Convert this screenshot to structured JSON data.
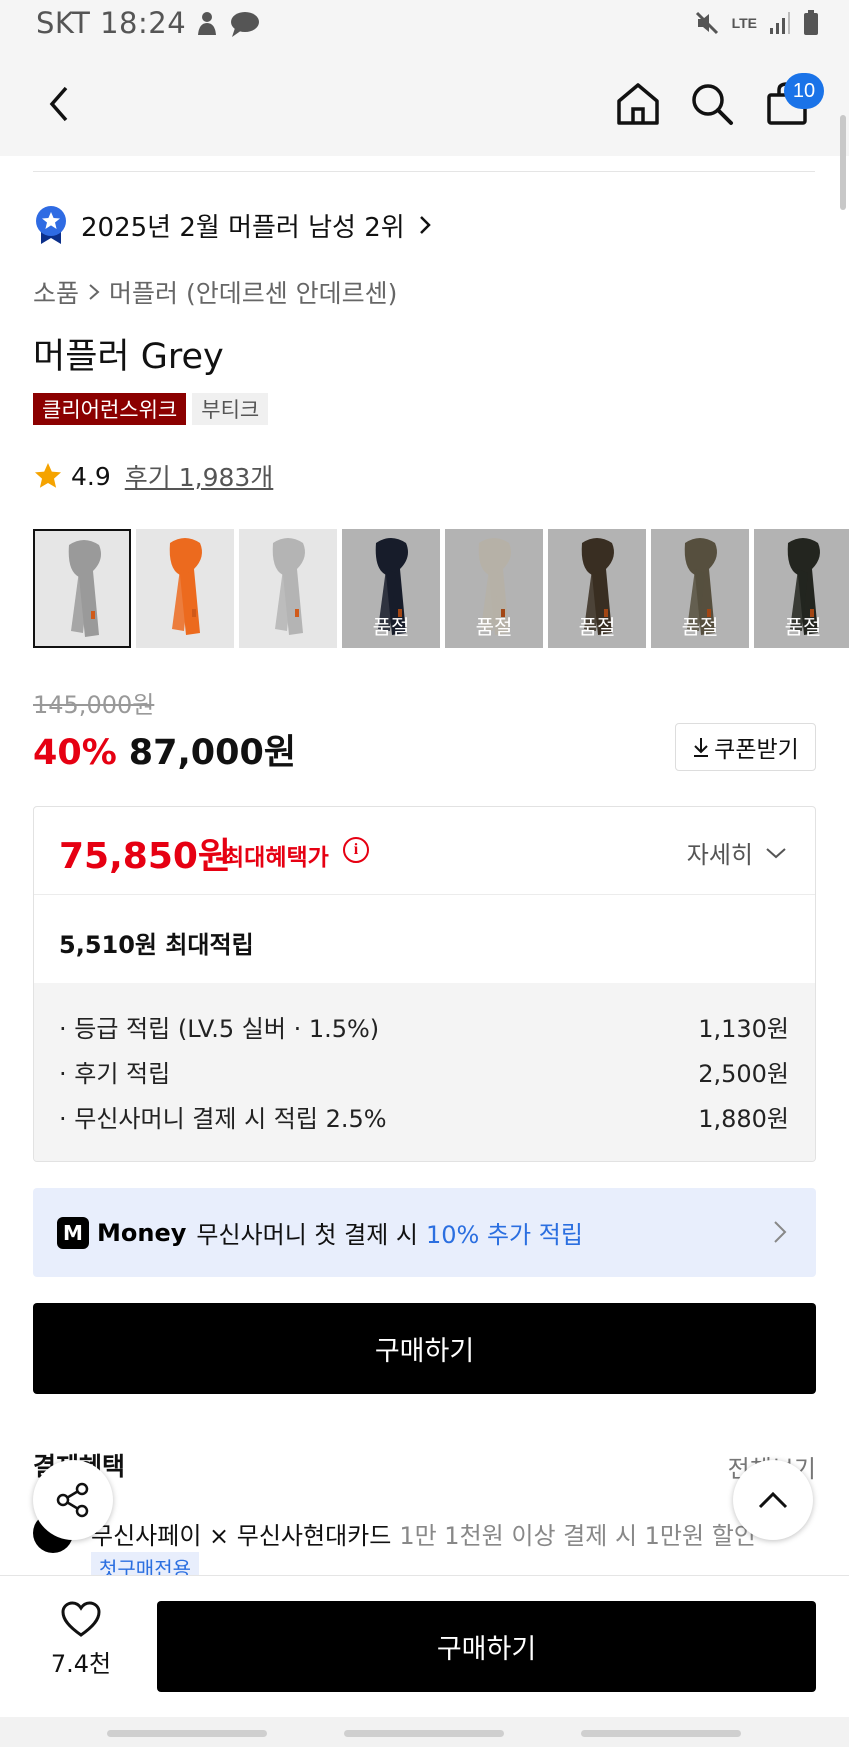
{
  "status_bar": {
    "carrier_time": "SKT 18:24",
    "network": "LTE"
  },
  "nav": {
    "cart_count": "10"
  },
  "rank": {
    "text": "2025년 2월 머플러 남성 2위"
  },
  "breadcrumb": {
    "category": "소품",
    "subcategory": "머플러 (안데르센 안데르센)"
  },
  "product": {
    "title": "머플러 Grey",
    "tags": [
      "클리어런스위크",
      "부티크"
    ],
    "rating": "4.9",
    "review_link": "후기 1,983개"
  },
  "thumbnails": [
    {
      "color": "#9a9a9a",
      "bg": "#e6e6e6",
      "soldout": "",
      "selected": true
    },
    {
      "color": "#ec6a1e",
      "bg": "#e6e6e6",
      "soldout": ""
    },
    {
      "color": "#b4b4b4",
      "bg": "#e6e6e6",
      "soldout": ""
    },
    {
      "color": "#1e2536",
      "bg": "#e6e6e6",
      "soldout": "품절"
    },
    {
      "color": "#e9e3d6",
      "bg": "#e6e6e6",
      "soldout": "품절"
    },
    {
      "color": "#4a3c2c",
      "bg": "#e6e6e6",
      "soldout": "품절"
    },
    {
      "color": "#6f6650",
      "bg": "#e6e6e6",
      "soldout": "품절"
    },
    {
      "color": "#2d3028",
      "bg": "#e6e6e6",
      "soldout": "품절"
    }
  ],
  "price": {
    "original": "145,000원",
    "discount": "40%",
    "sale": "87,000원",
    "coupon_button": "쿠폰받기"
  },
  "benefit": {
    "max_price": "75,850원",
    "max_label": "최대혜택가",
    "detail_label": "자세히",
    "points_total": "5,510원 최대적립",
    "items": [
      {
        "label": "· 등급 적립 (LV.5 실버 · 1.5%)",
        "value": "1,130원"
      },
      {
        "label": "· 후기 적립",
        "value": "2,500원"
      },
      {
        "label": "· 무신사머니 결제 시 적립 2.5%",
        "value": "1,880원"
      }
    ]
  },
  "money_banner": {
    "logo": "M",
    "brand": "Money",
    "text": "무신사머니 첫 결제 시",
    "highlight": "10% 추가 적립"
  },
  "buy_button": "구매하기",
  "payment": {
    "section_title": "결제혜택",
    "see_all": "전체보기",
    "row_text": "무신사페이 × 무신사현대카드",
    "row_sub": "1만 1천원 이상 결제 시 1만원 할인",
    "chip": "첫구매전용"
  },
  "bottom_bar": {
    "like_count": "7.4천",
    "buy_label": "구매하기"
  },
  "colors": {
    "accent_red": "#e60012",
    "blue": "#2b6fe0",
    "badge_blue": "#1a73e8",
    "tag_red": "#8b0000"
  }
}
